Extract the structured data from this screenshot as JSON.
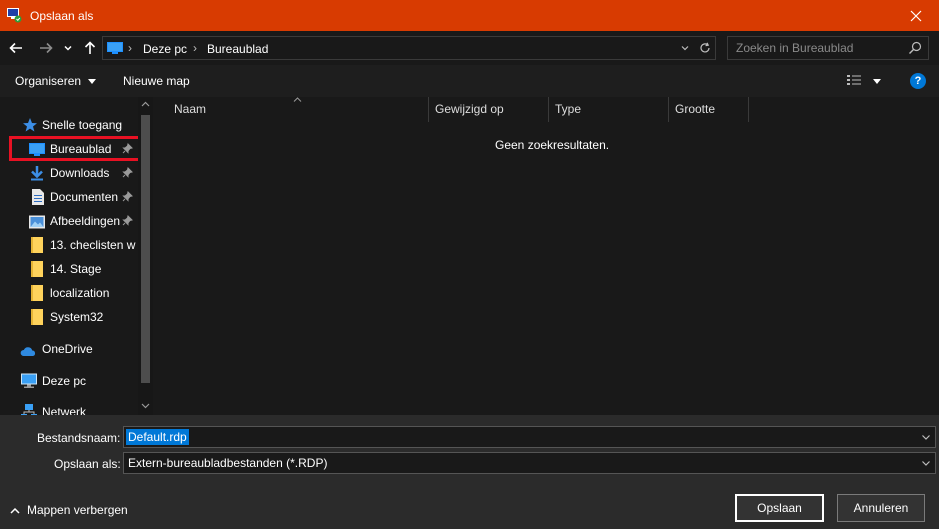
{
  "window": {
    "title": "Opslaan als"
  },
  "address": {
    "crumbs": [
      "Deze pc",
      "Bureaublad"
    ],
    "search_placeholder": "Zoeken in Bureaublad"
  },
  "toolbar": {
    "organize_label": "Organiseren",
    "new_folder_label": "Nieuwe map",
    "help_label": "?"
  },
  "sidebar": {
    "quick_access": "Snelle toegang",
    "items": [
      {
        "label": "Bureaublad",
        "icon": "desktop-icon",
        "pinned": true
      },
      {
        "label": "Downloads",
        "icon": "download-icon",
        "pinned": true
      },
      {
        "label": "Documenten",
        "icon": "document-icon",
        "pinned": true
      },
      {
        "label": "Afbeeldingen",
        "icon": "pictures-icon",
        "pinned": true
      },
      {
        "label": "13. checlisten  w",
        "icon": "folder-icon",
        "pinned": false
      },
      {
        "label": "14. Stage",
        "icon": "folder-icon",
        "pinned": false
      },
      {
        "label": "localization",
        "icon": "folder-icon",
        "pinned": false
      },
      {
        "label": "System32",
        "icon": "folder-icon",
        "pinned": false
      }
    ],
    "onedrive": "OneDrive",
    "this_pc": "Deze pc",
    "network": "Netwerk"
  },
  "columns": [
    "Naam",
    "Gewijzigd op",
    "Type",
    "Grootte"
  ],
  "empty_message": "Geen zoekresultaten.",
  "form": {
    "filename_label": "Bestandsnaam:",
    "filename_value": "Default.rdp",
    "savetype_label": "Opslaan als:",
    "savetype_value": "Extern-bureaubladbestanden (*.RDP)"
  },
  "footer": {
    "hide_folders_label": "Mappen verbergen",
    "save_label": "Opslaan",
    "cancel_label": "Annuleren"
  },
  "colors": {
    "titlebar": "#d83b01",
    "accent": "#0078d7",
    "highlight_box": "#e81123"
  }
}
